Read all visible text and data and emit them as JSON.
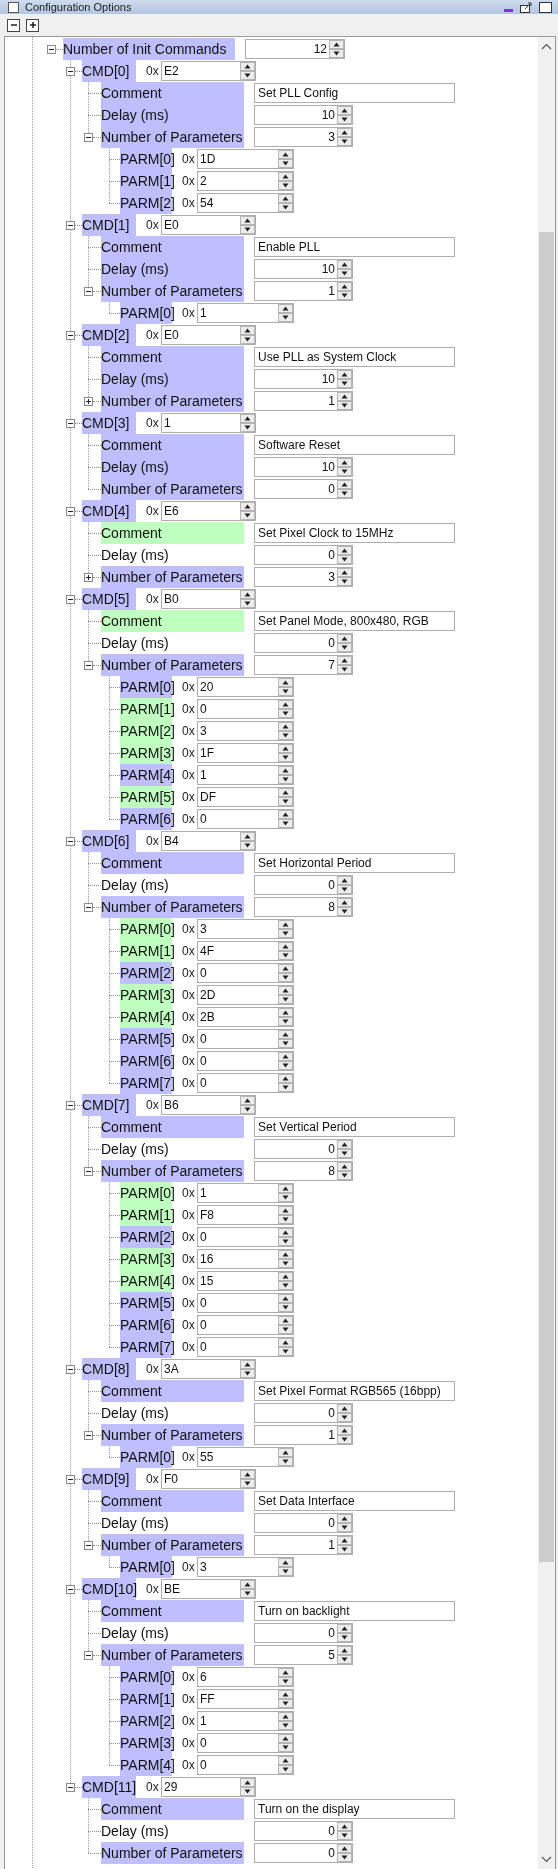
{
  "window": {
    "title": "Configuration Options"
  },
  "init": {
    "label": "Number of Init Commands",
    "value": "12",
    "expanded": true,
    "color": "#bfbfff"
  },
  "commands": [
    {
      "label": "CMD[0]",
      "prefix": "0x",
      "value": "E2",
      "expanded": true,
      "color": "#bfbfff",
      "comment": {
        "label": "Comment",
        "value": "Set PLL Config",
        "color": "#bfbfff"
      },
      "delay": {
        "label": "Delay (ms)",
        "value": "10",
        "color": "#bfbfff"
      },
      "params": {
        "label": "Number of Parameters",
        "value": "3",
        "color": "#bfbfff",
        "expanded": true,
        "items": [
          {
            "label": "PARM[0]",
            "prefix": "0x",
            "value": "1D",
            "color": "#bfbfff"
          },
          {
            "label": "PARM[1]",
            "prefix": "0x",
            "value": "2",
            "color": "#bfbfff"
          },
          {
            "label": "PARM[2]",
            "prefix": "0x",
            "value": "54",
            "color": "#bfbfff"
          }
        ]
      }
    },
    {
      "label": "CMD[1]",
      "prefix": "0x",
      "value": "E0",
      "expanded": true,
      "color": "#bfbfff",
      "comment": {
        "label": "Comment",
        "value": "Enable PLL",
        "color": "#bfbfff"
      },
      "delay": {
        "label": "Delay (ms)",
        "value": "10",
        "color": "#bfbfff"
      },
      "params": {
        "label": "Number of Parameters",
        "value": "1",
        "color": "#bfbfff",
        "expanded": true,
        "items": [
          {
            "label": "PARM[0]",
            "prefix": "0x",
            "value": "1",
            "color": "#bfbfff"
          }
        ]
      }
    },
    {
      "label": "CMD[2]",
      "prefix": "0x",
      "value": "E0",
      "expanded": true,
      "color": "#bfbfff",
      "comment": {
        "label": "Comment",
        "value": "Use PLL as System Clock",
        "color": "#bfbfff"
      },
      "delay": {
        "label": "Delay (ms)",
        "value": "10",
        "color": "#bfbfff"
      },
      "params": {
        "label": "Number of Parameters",
        "value": "1",
        "color": "#bfbfff",
        "expanded": false
      }
    },
    {
      "label": "CMD[3]",
      "prefix": "0x",
      "value": "1",
      "expanded": true,
      "color": "#bfbfff",
      "comment": {
        "label": "Comment",
        "value": "Software Reset",
        "color": "#bfbfff"
      },
      "delay": {
        "label": "Delay (ms)",
        "value": "10",
        "color": "#bfbfff"
      },
      "params": {
        "label": "Number of Parameters",
        "value": "0",
        "color": "#bfbfff"
      }
    },
    {
      "label": "CMD[4]",
      "prefix": "0x",
      "value": "E6",
      "expanded": true,
      "color": "#bfbfff",
      "comment": {
        "label": "Comment",
        "value": "Set Pixel Clock to 15MHz",
        "color": "#bfffbf"
      },
      "delay": {
        "label": "Delay (ms)",
        "value": "0"
      },
      "params": {
        "label": "Number of Parameters",
        "value": "3",
        "color": "#bfbfff",
        "expanded": false
      }
    },
    {
      "label": "CMD[5]",
      "prefix": "0x",
      "value": "B0",
      "expanded": true,
      "color": "#bfbfff",
      "comment": {
        "label": "Comment",
        "value": "Set Panel Mode, 800x480, RGB",
        "color": "#bfffbf"
      },
      "delay": {
        "label": "Delay (ms)",
        "value": "0"
      },
      "params": {
        "label": "Number of Parameters",
        "value": "7",
        "color": "#bfbfff",
        "expanded": true,
        "items": [
          {
            "label": "PARM[0]",
            "prefix": "0x",
            "value": "20",
            "color": "#bfbfff"
          },
          {
            "label": "PARM[1]",
            "prefix": "0x",
            "value": "0",
            "color": "#bfffbf"
          },
          {
            "label": "PARM[2]",
            "prefix": "0x",
            "value": "3",
            "color": "#bfffbf"
          },
          {
            "label": "PARM[3]",
            "prefix": "0x",
            "value": "1F",
            "color": "#bfffbf"
          },
          {
            "label": "PARM[4]",
            "prefix": "0x",
            "value": "1",
            "color": "#bfbfff"
          },
          {
            "label": "PARM[5]",
            "prefix": "0x",
            "value": "DF",
            "color": "#bfffbf"
          },
          {
            "label": "PARM[6]",
            "prefix": "0x",
            "value": "0",
            "color": "#bfbfff"
          }
        ]
      }
    },
    {
      "label": "CMD[6]",
      "prefix": "0x",
      "value": "B4",
      "expanded": true,
      "color": "#bfbfff",
      "comment": {
        "label": "Comment",
        "value": "Set Horizontal Period",
        "color": "#bfbfff"
      },
      "delay": {
        "label": "Delay (ms)",
        "value": "0"
      },
      "params": {
        "label": "Number of Parameters",
        "value": "8",
        "color": "#bfbfff",
        "expanded": true,
        "items": [
          {
            "label": "PARM[0]",
            "prefix": "0x",
            "value": "3",
            "color": "#bfffbf"
          },
          {
            "label": "PARM[1]",
            "prefix": "0x",
            "value": "4F",
            "color": "#bfffbf"
          },
          {
            "label": "PARM[2]",
            "prefix": "0x",
            "value": "0",
            "color": "#bfbfff"
          },
          {
            "label": "PARM[3]",
            "prefix": "0x",
            "value": "2D",
            "color": "#bfffbf"
          },
          {
            "label": "PARM[4]",
            "prefix": "0x",
            "value": "2B",
            "color": "#bfffbf"
          },
          {
            "label": "PARM[5]",
            "prefix": "0x",
            "value": "0",
            "color": "#bfbfff"
          },
          {
            "label": "PARM[6]",
            "prefix": "0x",
            "value": "0",
            "color": "#bfbfff"
          },
          {
            "label": "PARM[7]",
            "prefix": "0x",
            "value": "0",
            "color": "#bfbfff"
          }
        ]
      }
    },
    {
      "label": "CMD[7]",
      "prefix": "0x",
      "value": "B6",
      "expanded": true,
      "color": "#bfbfff",
      "comment": {
        "label": "Comment",
        "value": "Set Vertical Period",
        "color": "#bfbfff"
      },
      "delay": {
        "label": "Delay (ms)",
        "value": "0"
      },
      "params": {
        "label": "Number of Parameters",
        "value": "8",
        "color": "#bfbfff",
        "expanded": true,
        "items": [
          {
            "label": "PARM[0]",
            "prefix": "0x",
            "value": "1",
            "color": "#bfffbf"
          },
          {
            "label": "PARM[1]",
            "prefix": "0x",
            "value": "F8",
            "color": "#bfffbf"
          },
          {
            "label": "PARM[2]",
            "prefix": "0x",
            "value": "0",
            "color": "#bfbfff"
          },
          {
            "label": "PARM[3]",
            "prefix": "0x",
            "value": "16",
            "color": "#bfffbf"
          },
          {
            "label": "PARM[4]",
            "prefix": "0x",
            "value": "15",
            "color": "#bfffbf"
          },
          {
            "label": "PARM[5]",
            "prefix": "0x",
            "value": "0",
            "color": "#bfbfff"
          },
          {
            "label": "PARM[6]",
            "prefix": "0x",
            "value": "0",
            "color": "#bfbfff"
          },
          {
            "label": "PARM[7]",
            "prefix": "0x",
            "value": "0",
            "color": "#bfbfff"
          }
        ]
      }
    },
    {
      "label": "CMD[8]",
      "prefix": "0x",
      "value": "3A",
      "expanded": true,
      "color": "#bfbfff",
      "comment": {
        "label": "Comment",
        "value": "Set Pixel Format RGB565 (16bpp)",
        "color": "#bfbfff"
      },
      "delay": {
        "label": "Delay (ms)",
        "value": "0"
      },
      "params": {
        "label": "Number of Parameters",
        "value": "1",
        "color": "#bfbfff",
        "expanded": true,
        "items": [
          {
            "label": "PARM[0]",
            "prefix": "0x",
            "value": "55",
            "color": "#bfbfff"
          }
        ]
      }
    },
    {
      "label": "CMD[9]",
      "prefix": "0x",
      "value": "F0",
      "expanded": true,
      "color": "#bfbfff",
      "comment": {
        "label": "Comment",
        "value": "Set Data Interface",
        "color": "#bfbfff"
      },
      "delay": {
        "label": "Delay (ms)",
        "value": "0"
      },
      "params": {
        "label": "Number of Parameters",
        "value": "1",
        "color": "#bfbfff",
        "expanded": true,
        "items": [
          {
            "label": "PARM[0]",
            "prefix": "0x",
            "value": "3",
            "color": "#bfbfff"
          }
        ]
      }
    },
    {
      "label": "CMD[10]",
      "prefix": "0x",
      "value": "BE",
      "expanded": true,
      "color": "#bfbfff",
      "comment": {
        "label": "Comment",
        "value": "Turn on backlight",
        "color": "#bfbfff"
      },
      "delay": {
        "label": "Delay (ms)",
        "value": "0"
      },
      "params": {
        "label": "Number of Parameters",
        "value": "5",
        "color": "#bfbfff",
        "expanded": true,
        "items": [
          {
            "label": "PARM[0]",
            "prefix": "0x",
            "value": "6",
            "color": "#bfbfff"
          },
          {
            "label": "PARM[1]",
            "prefix": "0x",
            "value": "FF",
            "color": "#bfbfff"
          },
          {
            "label": "PARM[2]",
            "prefix": "0x",
            "value": "1",
            "color": "#bfbfff"
          },
          {
            "label": "PARM[3]",
            "prefix": "0x",
            "value": "0",
            "color": "#bfbfff"
          },
          {
            "label": "PARM[4]",
            "prefix": "0x",
            "value": "0",
            "color": "#bfbfff"
          }
        ]
      }
    },
    {
      "label": "CMD[11]",
      "prefix": "0x",
      "value": "29",
      "expanded": true,
      "color": "#bfbfff",
      "comment": {
        "label": "Comment",
        "value": "Turn on the display",
        "color": "#bfbfff"
      },
      "delay": {
        "label": "Delay (ms)",
        "value": "0"
      },
      "params": {
        "label": "Number of Parameters",
        "value": "0",
        "color": "#bfbfff"
      }
    }
  ]
}
